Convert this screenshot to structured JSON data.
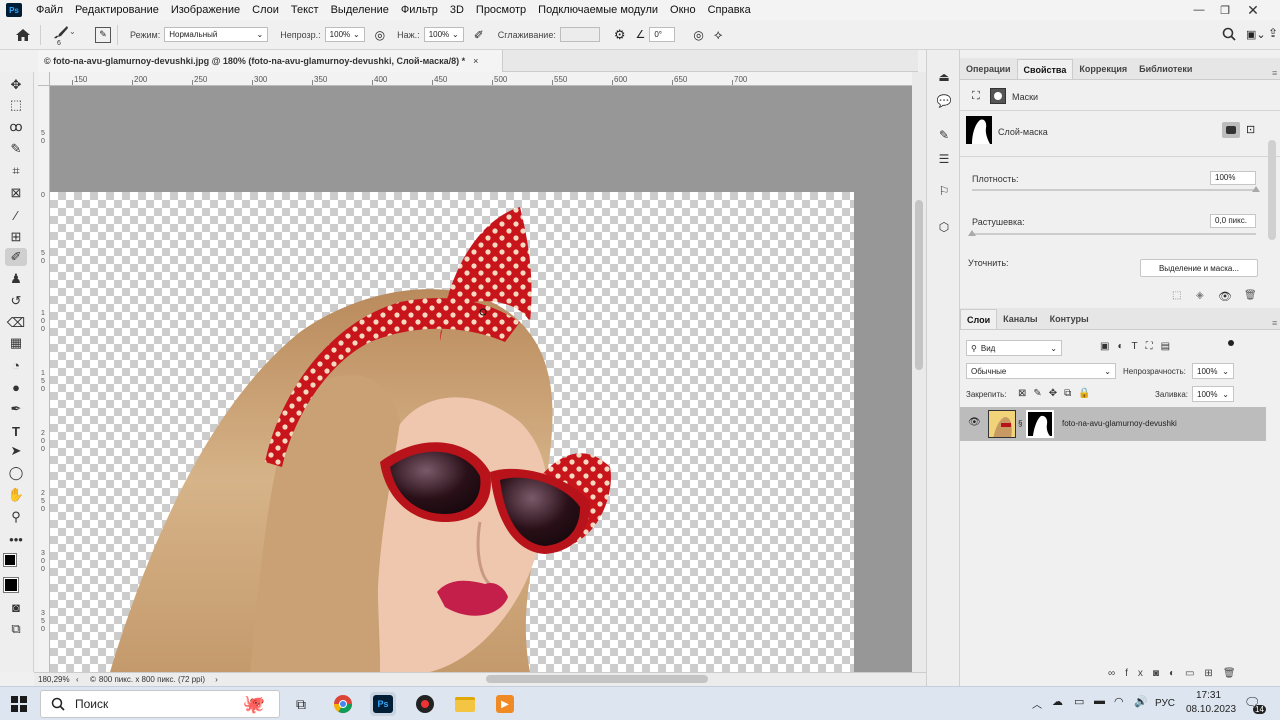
{
  "menu": [
    "Файл",
    "Редактирование",
    "Изображение",
    "Слои",
    "Текст",
    "Выделение",
    "Фильтр",
    "3D",
    "Просмотр",
    "Подключаемые модули",
    "Окно",
    "Справка"
  ],
  "options": {
    "brush_size": "6",
    "mode_label": "Режим:",
    "mode_value": "Нормальный",
    "opacity_label": "Непрозр.:",
    "opacity_value": "100%",
    "flow_label": "Наж.:",
    "flow_value": "100%",
    "smoothing_label": "Сглаживание:",
    "smoothing_value": "",
    "angle_value": "0°"
  },
  "document": {
    "tab_title": "© foto-na-avu-glamurnoy-devushki.jpg @ 180% (foto-na-avu-glamurnoy-devushki, Слой-маска/8) *",
    "close": "×"
  },
  "ruler_top": [
    "150",
    "200",
    "250",
    "300",
    "350",
    "400",
    "450",
    "500",
    "550",
    "600",
    "650",
    "700"
  ],
  "ruler_left": [
    "5",
    "0",
    "0",
    "5",
    "0",
    "1",
    "0",
    "0",
    "1",
    "5",
    "0",
    "2",
    "0",
    "0",
    "2",
    "5",
    "0",
    "3",
    "0",
    "0",
    "3",
    "5",
    "0"
  ],
  "status": {
    "zoom": "180,29%",
    "info": "800 пикс. x 800 пикс. (72 ppi)"
  },
  "properties_panel": {
    "tabs": [
      "Операции",
      "Свойства",
      "Коррекция",
      "Библиотеки"
    ],
    "active_tab": "Свойства",
    "masks_label": "Маски",
    "layer_mask_label": "Слой-маска",
    "density_label": "Плотность:",
    "density_value": "100%",
    "density_level": 1.0,
    "feather_label": "Растушевка:",
    "feather_value": "0,0 пикс.",
    "feather_level": 0.0,
    "refine_label": "Уточнить:",
    "select_mask_button": "Выделение и маска..."
  },
  "layers_panel": {
    "tabs": [
      "Слои",
      "Каналы",
      "Контуры"
    ],
    "active_tab": "Слои",
    "filter_kind": "Вид",
    "blend_mode": "Обычные",
    "opacity_label": "Непрозрачность:",
    "opacity_value": "100%",
    "lock_label": "Закрепить:",
    "fill_label": "Заливка:",
    "fill_value": "100%",
    "layer_name": "foto-na-avu-glamurnoy-devushki"
  },
  "taskbar": {
    "search_label": "Поиск",
    "language": "РУС",
    "time": "17:31",
    "date": "08.10.2023",
    "notification_count": "14"
  },
  "colors": {
    "accent_blue": "#1473e6",
    "ps_dark": "#001e36",
    "ps_light": "#31a8ff",
    "ribbon_red": "#c8151c"
  }
}
